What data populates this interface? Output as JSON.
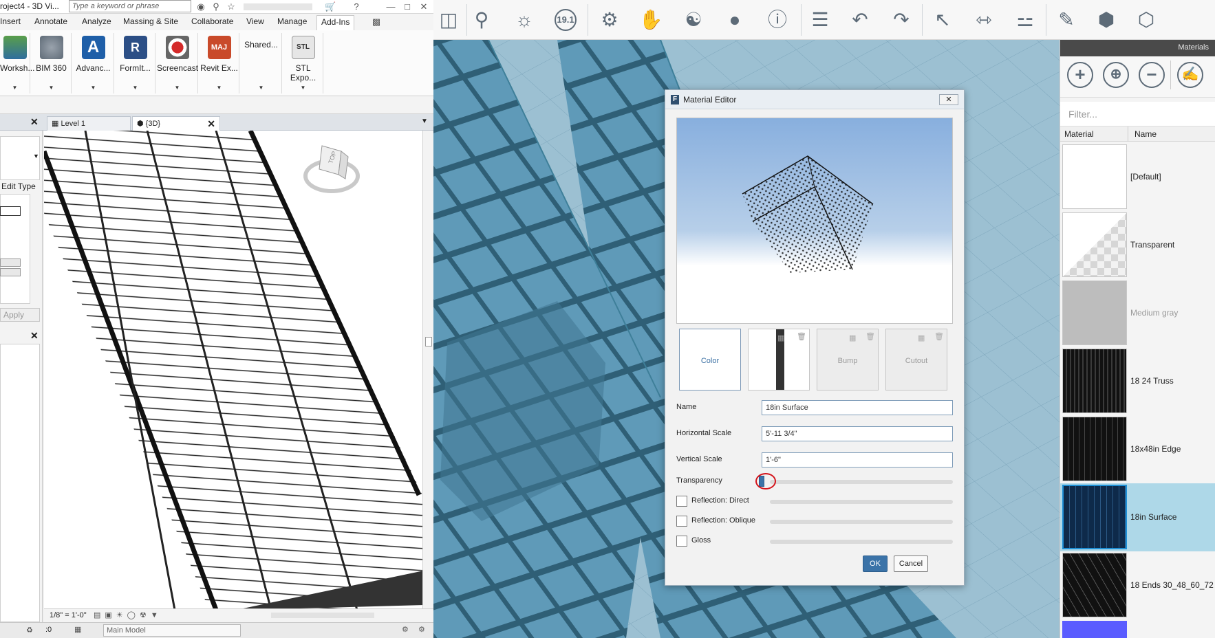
{
  "revit": {
    "title_fragment": "roject4 - 3D Vi...",
    "search_placeholder": "Type a keyword or phrase",
    "ribbon_tabs": [
      "Insert",
      "Annotate",
      "Analyze",
      "Massing & Site",
      "Collaborate",
      "View",
      "Manage",
      "Add-Ins"
    ],
    "active_tab": "Add-Ins",
    "ribbon_buttons": [
      "Worksh...",
      "BIM 360",
      "Advanc...",
      "FormIt...",
      "Screencast",
      "Revit Ex...",
      "Shared...",
      "STL Expo..."
    ],
    "view_tabs": [
      "Level 1",
      "{3D}"
    ],
    "properties": {
      "edit_type": "Edit Type",
      "apply": "Apply"
    },
    "viewcube_label": "TOP",
    "scale": "1/8\" = 1'-0\"",
    "status": {
      "selection_count": ":0",
      "model": "Main Model"
    }
  },
  "formit": {
    "toolbar_badge": "19.1",
    "materials": {
      "panel_title": "Materials",
      "filter_placeholder": "Filter...",
      "columns": [
        "Material",
        "Name"
      ],
      "items": [
        {
          "name": "[Default]",
          "muted": false,
          "selected": false
        },
        {
          "name": "Transparent",
          "muted": false,
          "selected": false
        },
        {
          "name": "Medium gray",
          "muted": true,
          "selected": false
        },
        {
          "name": "18 24 Truss",
          "muted": false,
          "selected": false
        },
        {
          "name": "18x48in Edge",
          "muted": false,
          "selected": false
        },
        {
          "name": "18in Surface",
          "muted": false,
          "selected": true
        },
        {
          "name": "18 Ends 30_48_60_72",
          "muted": false,
          "selected": false
        }
      ]
    },
    "material_editor": {
      "title": "Material Editor",
      "maps": {
        "color": "Color",
        "bump": "Bump",
        "cutout": "Cutout"
      },
      "fields": {
        "name_label": "Name",
        "name_value": "18in Surface",
        "hscale_label": "Horizontal Scale",
        "hscale_value": "5'-11 3/4\"",
        "vscale_label": "Vertical Scale",
        "vscale_value": "1'-6\""
      },
      "sliders": {
        "transparency_label": "Transparency",
        "transparency": 0,
        "reflection_direct_label": "Reflection: Direct",
        "reflection_direct_checked": false,
        "reflection_oblique_label": "Reflection: Oblique",
        "reflection_oblique_checked": false,
        "gloss_label": "Gloss",
        "gloss_checked": false
      },
      "ok_label": "OK",
      "cancel_label": "Cancel"
    },
    "colors": {
      "accent": "#3b73a8",
      "selection": "#aed8e8",
      "scene": "#8fb6c8",
      "highlight_circle": "#d4141b"
    }
  }
}
